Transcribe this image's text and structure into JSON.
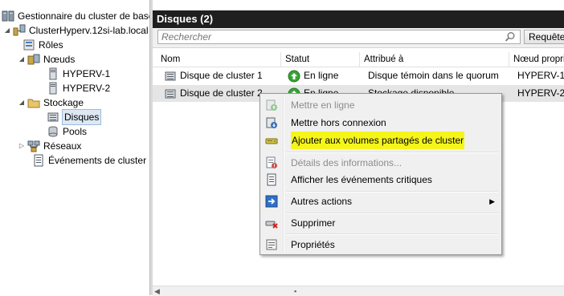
{
  "tree": {
    "root": "Gestionnaire du cluster de basculement",
    "cluster": "ClusterHyperv.12si-lab.local",
    "roles": "Rôles",
    "nodes": "Nœuds",
    "node1": "HYPERV-1",
    "node2": "HYPERV-2",
    "storage": "Stockage",
    "disks": "Disques",
    "pools": "Pools",
    "networks": "Réseaux",
    "events": "Événements de cluster"
  },
  "main": {
    "title": "Disques (2)",
    "search_placeholder": "Rechercher",
    "query_button": "Requêtes",
    "columns": [
      "Nom",
      "Statut",
      "Attribué à",
      "Nœud propriétaire"
    ],
    "rows": [
      {
        "name": "Disque de cluster 1",
        "status": "En ligne",
        "assigned": "Disque témoin dans le quorum",
        "owner": "HYPERV-1"
      },
      {
        "name": "Disque de cluster 2",
        "status": "En ligne",
        "assigned": "Stockage disponible",
        "owner": "HYPERV-2"
      }
    ]
  },
  "context_menu": {
    "bring_online": "Mettre en ligne",
    "take_offline": "Mettre hors connexion",
    "add_to_csv": "Ajouter aux volumes partagés de cluster",
    "info_details": "Détails des informations...",
    "show_critical_events": "Afficher les événements critiques",
    "more_actions": "Autres actions",
    "delete": "Supprimer",
    "properties": "Propriétés"
  },
  "colors": {
    "header_bg": "#1f1f1f",
    "highlight": "#f6f51b",
    "online_green": "#3aa335"
  }
}
